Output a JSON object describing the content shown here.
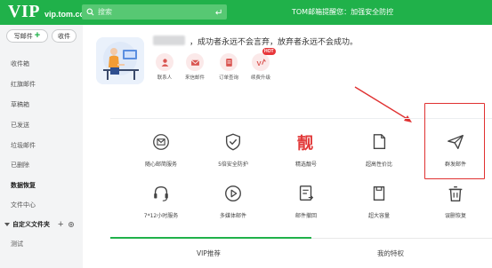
{
  "header": {
    "logo_main": "VIP",
    "logo_domain": "vip.tom.com",
    "search_placeholder": "搜索",
    "notice": "TOM邮箱提醒您：加强安全防控"
  },
  "sidebar": {
    "write_label": "写邮件",
    "inbox_button_label": "收件",
    "items": [
      "收件箱",
      "红旗邮件",
      "草稿箱",
      "已发送",
      "垃圾邮件",
      "已删除",
      "数据恢复",
      "文件中心"
    ],
    "custom_folder_label": "自定义文件夹",
    "custom_folders": [
      "测试"
    ]
  },
  "profile": {
    "motto": "，成功者永远不会言弃，放弃者永远不会成功。"
  },
  "quick_actions": [
    {
      "label": "联系人",
      "icon": "contacts-icon"
    },
    {
      "label": "来信邮件",
      "icon": "mail-icon"
    },
    {
      "label": "订单查询",
      "icon": "order-icon"
    },
    {
      "label": "续费升级",
      "icon": "vip-upgrade-icon",
      "badge": "HOT"
    }
  ],
  "features": [
    {
      "label": "随心邮简服务",
      "icon": "mail-service-icon"
    },
    {
      "label": "5倍安全防护",
      "icon": "shield-icon"
    },
    {
      "label": "精选靓号",
      "icon": "premium-number-icon"
    },
    {
      "label": "超高性价比",
      "icon": "value-icon"
    },
    {
      "label": "群发邮件",
      "icon": "paper-plane-icon"
    },
    {
      "label": "7*12小时服务",
      "icon": "headset-icon"
    },
    {
      "label": "多媒体邮件",
      "icon": "play-icon"
    },
    {
      "label": "邮件撤回",
      "icon": "recall-icon"
    },
    {
      "label": "超大容量",
      "icon": "storage-icon"
    },
    {
      "label": "误删恢复",
      "icon": "trash-restore-icon"
    }
  ],
  "tabs": [
    {
      "label": "VIP推荐",
      "active": true
    },
    {
      "label": "我的特权",
      "active": false
    }
  ],
  "colors": {
    "brand_green": "#20b14a",
    "highlight_red": "#e03131",
    "premium_red": "#e23b3b"
  }
}
